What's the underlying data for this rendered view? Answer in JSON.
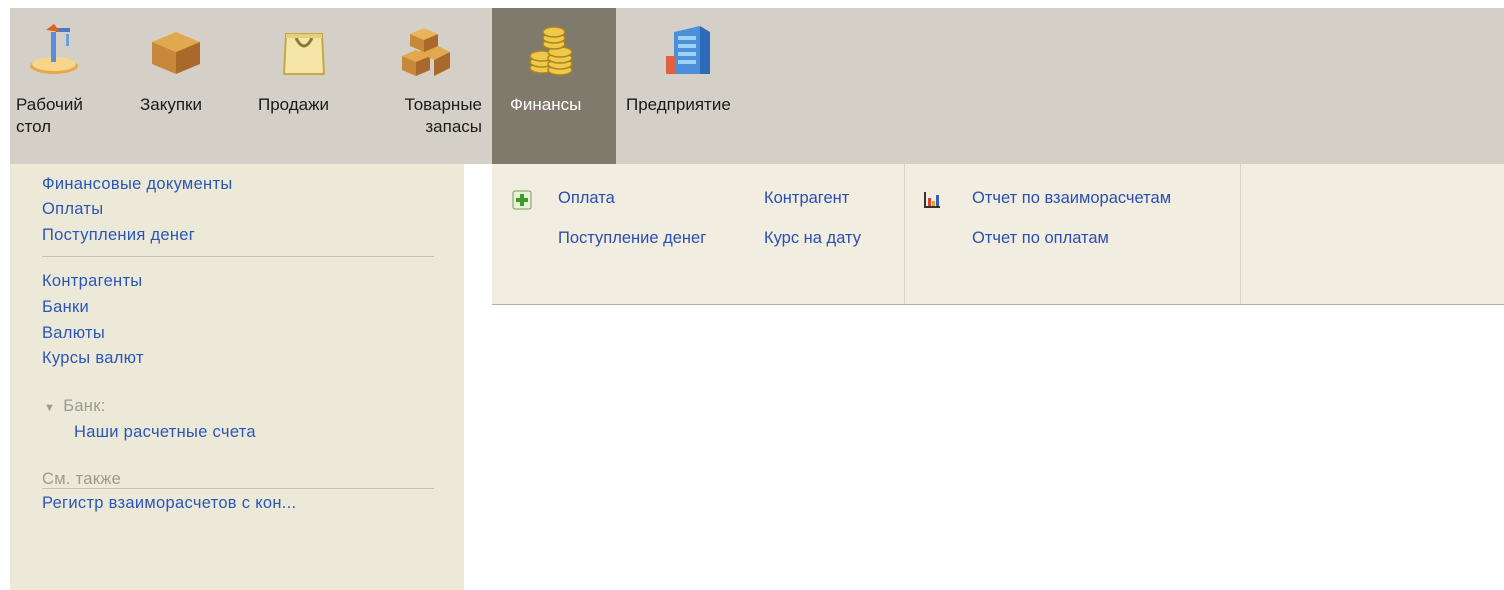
{
  "sections": [
    {
      "label": "Рабочий\nстол",
      "icon": "desk-lamp-icon",
      "active": false
    },
    {
      "label": "Закупки",
      "icon": "cardboard-box-icon",
      "active": false
    },
    {
      "label": "Продажи",
      "icon": "shopping-bag-icon",
      "active": false
    },
    {
      "label": "Товарные\nзапасы",
      "icon": "stacked-boxes-icon",
      "active": false
    },
    {
      "label": "Финансы",
      "icon": "coins-icon",
      "active": true
    },
    {
      "label": "Предприятие",
      "icon": "building-icon",
      "active": false
    }
  ],
  "nav": {
    "group1": [
      "Финансовые документы",
      "Оплаты",
      "Поступления денег"
    ],
    "group2": [
      "Контрагенты",
      "Банки",
      "Валюты",
      "Курсы валют"
    ],
    "bank_group": {
      "title": "Банк:",
      "items": [
        "Наши расчетные счета"
      ]
    },
    "see_also": {
      "title": "См. также",
      "items": [
        "Регистр взаиморасчетов с кон..."
      ]
    }
  },
  "commands": {
    "create": [
      "Оплата",
      "Поступление денег"
    ],
    "other": [
      "Контрагент",
      "Курс на дату"
    ],
    "reports": [
      "Отчет по взаиморасчетам",
      "Отчет по оплатам"
    ]
  },
  "colors": {
    "active_tab": "#807a6c",
    "link": "#2a56b8",
    "toolbar": "#d4d0c8",
    "panel": "#ece9d8"
  }
}
